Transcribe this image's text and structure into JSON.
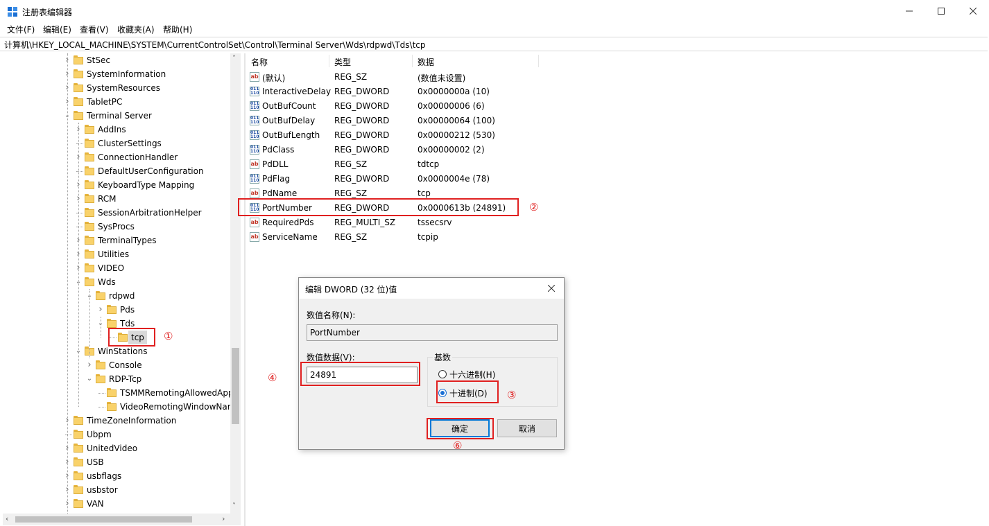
{
  "window": {
    "title": "注册表编辑器",
    "minimize": "—",
    "maximize": "☐",
    "close": "✕"
  },
  "menu": [
    "文件(F)",
    "编辑(E)",
    "查看(V)",
    "收藏夹(A)",
    "帮助(H)"
  ],
  "address": "计算机\\HKEY_LOCAL_MACHINE\\SYSTEM\\CurrentControlSet\\Control\\Terminal Server\\Wds\\rdpwd\\Tds\\tcp",
  "tree": [
    {
      "label": "StSec",
      "expandable": true
    },
    {
      "label": "SystemInformation",
      "expandable": true
    },
    {
      "label": "SystemResources",
      "expandable": true
    },
    {
      "label": "TabletPC",
      "expandable": true
    },
    {
      "label": "Terminal Server",
      "expanded": true
    },
    {
      "label": "AddIns",
      "expandable": true
    },
    {
      "label": "ClusterSettings",
      "expandable": false
    },
    {
      "label": "ConnectionHandler",
      "expandable": true
    },
    {
      "label": "DefaultUserConfiguration",
      "expandable": false
    },
    {
      "label": "KeyboardType Mapping",
      "expandable": true
    },
    {
      "label": "RCM",
      "expandable": true
    },
    {
      "label": "SessionArbitrationHelper",
      "expandable": false
    },
    {
      "label": "SysProcs",
      "expandable": false
    },
    {
      "label": "TerminalTypes",
      "expandable": true
    },
    {
      "label": "Utilities",
      "expandable": true
    },
    {
      "label": "VIDEO",
      "expandable": true
    },
    {
      "label": "Wds",
      "expanded": true
    },
    {
      "label": "rdpwd",
      "expanded": true
    },
    {
      "label": "Pds",
      "expandable": true
    },
    {
      "label": "Tds",
      "expanded": true
    },
    {
      "label": "tcp",
      "selected": true
    },
    {
      "label": "WinStations",
      "expanded": true
    },
    {
      "label": "Console",
      "expandable": true
    },
    {
      "label": "RDP-Tcp",
      "expanded": true
    },
    {
      "label": "TSMMRemotingAllowedApp",
      "expandable": false
    },
    {
      "label": "VideoRemotingWindowNar",
      "expandable": false
    },
    {
      "label": "TimeZoneInformation",
      "expandable": true
    },
    {
      "label": "Ubpm",
      "expandable": false
    },
    {
      "label": "UnitedVideo",
      "expandable": true
    },
    {
      "label": "USB",
      "expandable": true
    },
    {
      "label": "usbflags",
      "expandable": true
    },
    {
      "label": "usbstor",
      "expandable": true
    },
    {
      "label": "VAN",
      "expandable": true
    }
  ],
  "list": {
    "columns": [
      "名称",
      "类型",
      "数据"
    ],
    "rows": [
      {
        "name": "(默认)",
        "type": "REG_SZ",
        "data": "(数值未设置)",
        "kind": "sz"
      },
      {
        "name": "InteractiveDelay",
        "type": "REG_DWORD",
        "data": "0x0000000a (10)",
        "kind": "dw"
      },
      {
        "name": "OutBufCount",
        "type": "REG_DWORD",
        "data": "0x00000006 (6)",
        "kind": "dw"
      },
      {
        "name": "OutBufDelay",
        "type": "REG_DWORD",
        "data": "0x00000064 (100)",
        "kind": "dw"
      },
      {
        "name": "OutBufLength",
        "type": "REG_DWORD",
        "data": "0x00000212 (530)",
        "kind": "dw"
      },
      {
        "name": "PdClass",
        "type": "REG_DWORD",
        "data": "0x00000002 (2)",
        "kind": "dw"
      },
      {
        "name": "PdDLL",
        "type": "REG_SZ",
        "data": "tdtcp",
        "kind": "sz"
      },
      {
        "name": "PdFlag",
        "type": "REG_DWORD",
        "data": "0x0000004e (78)",
        "kind": "dw"
      },
      {
        "name": "PdName",
        "type": "REG_SZ",
        "data": "tcp",
        "kind": "sz"
      },
      {
        "name": "PortNumber",
        "type": "REG_DWORD",
        "data": "0x0000613b (24891)",
        "kind": "dw"
      },
      {
        "name": "RequiredPds",
        "type": "REG_MULTI_SZ",
        "data": "tssecsrv",
        "kind": "sz"
      },
      {
        "name": "ServiceName",
        "type": "REG_SZ",
        "data": "tcpip",
        "kind": "sz"
      }
    ]
  },
  "icons": {
    "sz": "ab",
    "dw": "011\n110"
  },
  "dialog": {
    "title": "编辑 DWORD (32 位)值",
    "close": "✕",
    "name_label": "数值名称(N):",
    "name_value": "PortNumber",
    "data_label": "数值数据(V):",
    "data_value": "24891",
    "base_label": "基数",
    "hex_label": "十六进制(H)",
    "dec_label": "十进制(D)",
    "selected_base": "十进制(D)",
    "ok": "确定",
    "cancel": "取消"
  },
  "annotations": {
    "m1": "①",
    "m2": "②",
    "m3": "③",
    "m4": "④",
    "m6": "⑥"
  },
  "colors": {
    "annotation": "#e02020",
    "selection": "#d9d9d9",
    "accent": "#0078d7"
  }
}
